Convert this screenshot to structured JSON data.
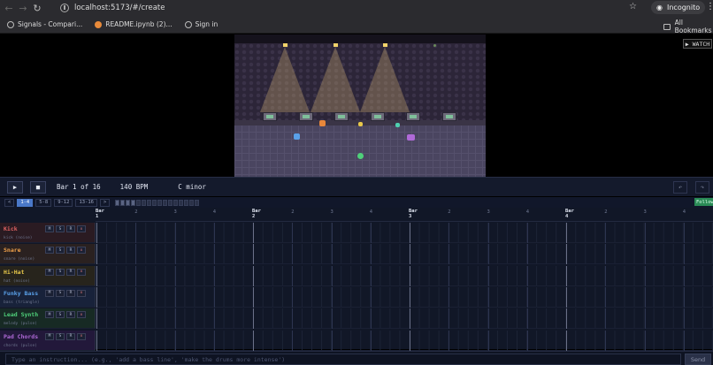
{
  "browser": {
    "url": "localhost:5173/#/create",
    "profile_label": "Incognito",
    "bookmarks": [
      {
        "label": "Signals - Compari...",
        "icon": "globe-icon"
      },
      {
        "label": "README.ipynb (2)...",
        "icon": "jupyter-icon"
      },
      {
        "label": "Sign in",
        "icon": "globe-icon"
      }
    ],
    "all_bookmarks_label": "All Bookmarks"
  },
  "stage": {
    "watch_label": "▶ WATCH"
  },
  "transport": {
    "play_icon": "▶",
    "stop_icon": "■",
    "position": "Bar 1 of 16",
    "tempo": "140 BPM",
    "key": "C minor",
    "undo_icon": "↶",
    "redo_icon": "↷"
  },
  "barnav": {
    "prev": "<",
    "ranges": [
      "1-4",
      "5-8",
      "9-12",
      "13-16"
    ],
    "active_range": "1-4",
    "next": ">",
    "follow_label": "Follow"
  },
  "ruler": {
    "bars": [
      {
        "label": "Bar",
        "number": "1",
        "beats": [
          "2",
          "3",
          "4"
        ]
      },
      {
        "label": "Bar",
        "number": "2",
        "beats": [
          "2",
          "3",
          "4"
        ]
      },
      {
        "label": "Bar",
        "number": "3",
        "beats": [
          "2",
          "3",
          "4"
        ]
      },
      {
        "label": "Bar",
        "number": "4",
        "beats": [
          "2",
          "3",
          "4"
        ]
      }
    ]
  },
  "track_buttons": {
    "mute": "M",
    "solo": "S",
    "record": "R",
    "delete": "x"
  },
  "tracks": [
    {
      "name": "Kick",
      "sub": "kick (noise)",
      "color": "#e06262",
      "bg": "#2a1b22"
    },
    {
      "name": "Snare",
      "sub": "snare (noise)",
      "color": "#f0a14a",
      "bg": "#2a2120"
    },
    {
      "name": "Hi-Hat",
      "sub": "hat (noise)",
      "color": "#e8c84a",
      "bg": "#27241c"
    },
    {
      "name": "Funky Bass",
      "sub": "bass (triangle)",
      "color": "#5aa0e8",
      "bg": "#18223a"
    },
    {
      "name": "Lead Synth",
      "sub": "melody (pulse)",
      "color": "#4fd07a",
      "bg": "#172a24"
    },
    {
      "name": "Pad Chords",
      "sub": "chords (pulse)",
      "color": "#b06ad8",
      "bg": "#22183a"
    }
  ],
  "input": {
    "placeholder": "Type an instruction... (e.g., 'add a bass line', 'make the drums more intense')",
    "send_label": "Send"
  },
  "colors": {
    "accent": "#4a78c8",
    "follow": "#2a8a56",
    "background": "#111727"
  }
}
